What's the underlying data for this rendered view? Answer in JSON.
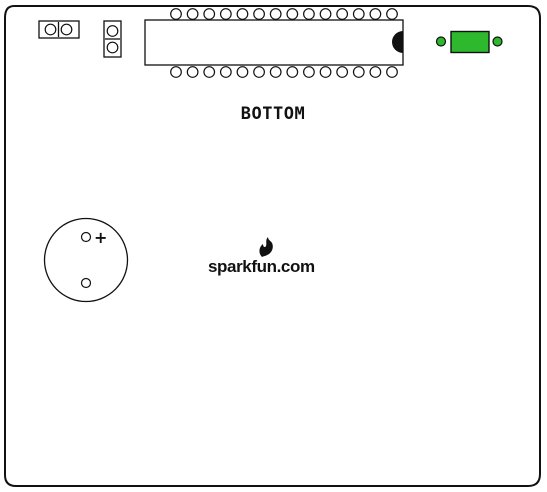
{
  "board": {
    "side_label": "BOTTOM",
    "logo_text": "sparkfun.com",
    "buzzer_polarity": "+"
  },
  "components": {
    "chip_pins_per_row": 14,
    "led_color": "#2eb82e",
    "icons": [
      "two-pin-header-horizontal-icon",
      "two-pin-header-vertical-icon",
      "dip-ic-icon",
      "smd-led-icon",
      "buzzer-icon",
      "sparkfun-flame-icon"
    ]
  }
}
